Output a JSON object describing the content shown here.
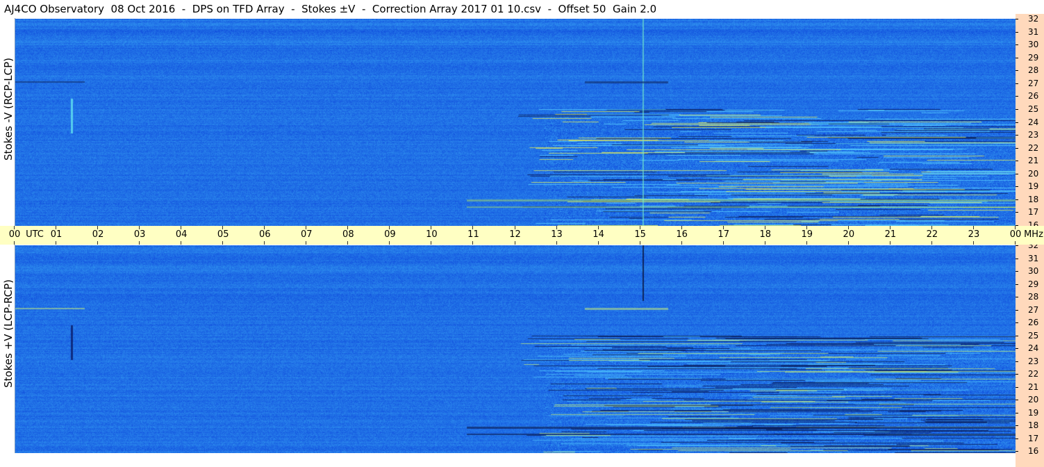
{
  "title": "AJ4CO Observatory  08 Oct 2016  -  DPS on TFD Array  -  Stokes ±V  -  Correction Array 2017 01 10.csv  -  Offset 50  Gain 2.0",
  "panels": {
    "top": {
      "label": "Stokes -V (RCP-LCP)"
    },
    "bottom": {
      "label": "Stokes +V (LCP-RCP)"
    }
  },
  "time_axis": {
    "labels": [
      "00",
      "01",
      "02",
      "03",
      "04",
      "05",
      "06",
      "07",
      "08",
      "09",
      "10",
      "11",
      "12",
      "13",
      "14",
      "15",
      "16",
      "17",
      "18",
      "19",
      "20",
      "21",
      "22",
      "23",
      "00"
    ],
    "first_unit": "UTC",
    "last_unit": "MHz"
  },
  "freq_axis": {
    "labels": [
      "32",
      "31",
      "30",
      "29",
      "28",
      "27",
      "26",
      "25",
      "24",
      "23",
      "22",
      "21",
      "20",
      "19",
      "18",
      "17",
      "16"
    ]
  },
  "colors": {
    "background": "#ffffff",
    "timebar": "#ffffc3",
    "freqbar": "#ffd9bc",
    "spectrogram_base": "#1f6fe0"
  }
}
